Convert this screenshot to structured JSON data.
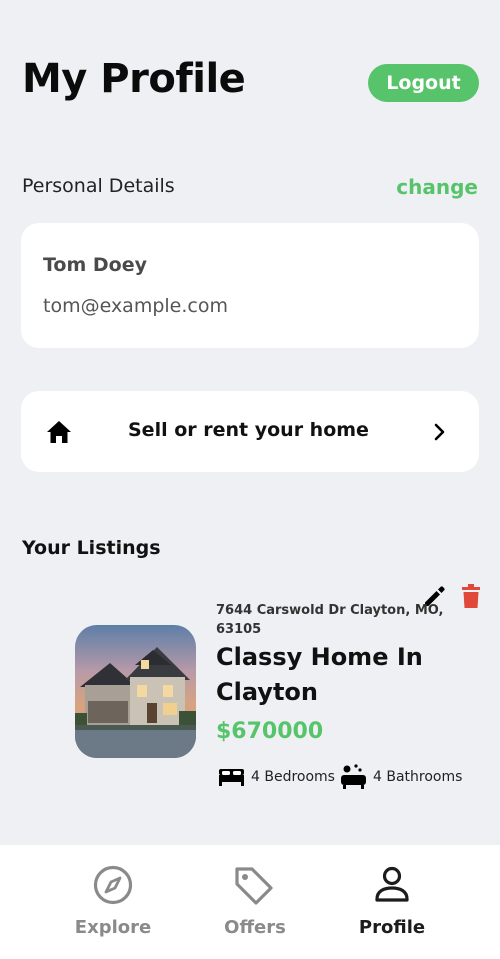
{
  "header": {
    "title": "My Profile",
    "logout_label": "Logout"
  },
  "personal_details": {
    "section_label": "Personal Details",
    "change_label": "change",
    "name": "Tom Doey",
    "email": "tom@example.com"
  },
  "sell_card": {
    "label": "Sell or rent your home",
    "icon": "home-icon"
  },
  "listings": {
    "section_label": "Your Listings",
    "items": [
      {
        "address": "7644 Carswold Dr Clayton, MO, 63105",
        "title": "Classy Home In Clayton",
        "price": "$670000",
        "bedrooms": "4 Bedrooms",
        "bathrooms": "4 Bathrooms"
      }
    ]
  },
  "tabs": [
    {
      "label": "Explore",
      "icon": "compass-icon",
      "active": false
    },
    {
      "label": "Offers",
      "icon": "tag-icon",
      "active": false
    },
    {
      "label": "Profile",
      "icon": "person-icon",
      "active": true
    }
  ],
  "colors": {
    "accent": "#57c46b",
    "delete": "#e0483a",
    "background": "#eef0f4"
  }
}
